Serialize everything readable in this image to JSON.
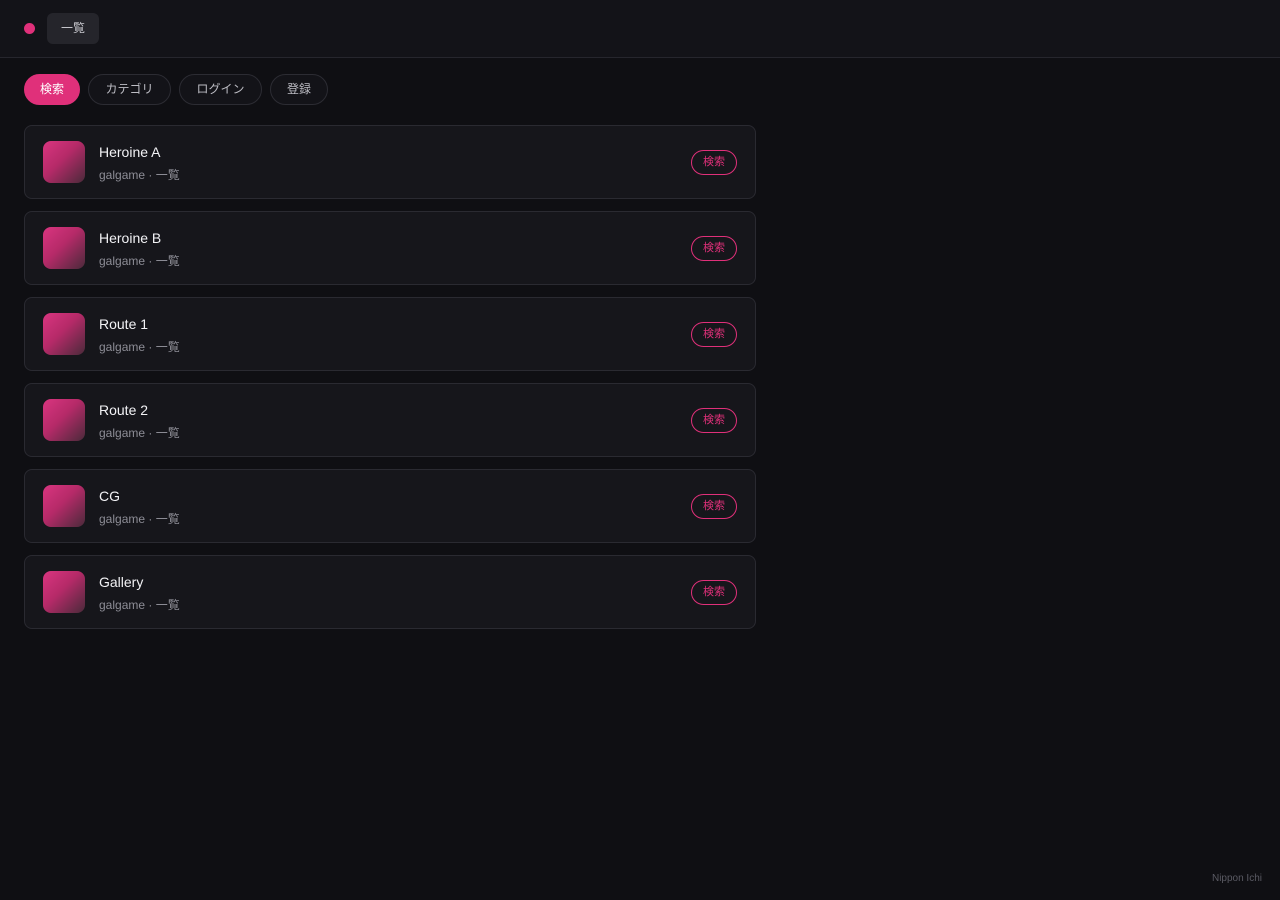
{
  "header": {
    "tab_label": "一覧"
  },
  "filters": [
    {
      "label": "検索",
      "active": true
    },
    {
      "label": "カテゴリ",
      "active": false
    },
    {
      "label": "ログイン",
      "active": false
    },
    {
      "label": "登録",
      "active": false
    }
  ],
  "items": [
    {
      "title": "Heroine A",
      "meta": "galgame · 一覧",
      "action": "検索"
    },
    {
      "title": "Heroine B",
      "meta": "galgame · 一覧",
      "action": "検索"
    },
    {
      "title": "Route 1",
      "meta": "galgame · 一覧",
      "action": "検索"
    },
    {
      "title": "Route 2",
      "meta": "galgame · 一覧",
      "action": "検索"
    },
    {
      "title": "CG",
      "meta": "galgame · 一覧",
      "action": "検索"
    },
    {
      "title": "Gallery",
      "meta": "galgame · 一覧",
      "action": "検索"
    }
  ],
  "footer": {
    "credit": "Nippon Ichi"
  },
  "colors": {
    "accent": "#e0307a",
    "background": "#0f0f13",
    "card": "#16161b"
  }
}
